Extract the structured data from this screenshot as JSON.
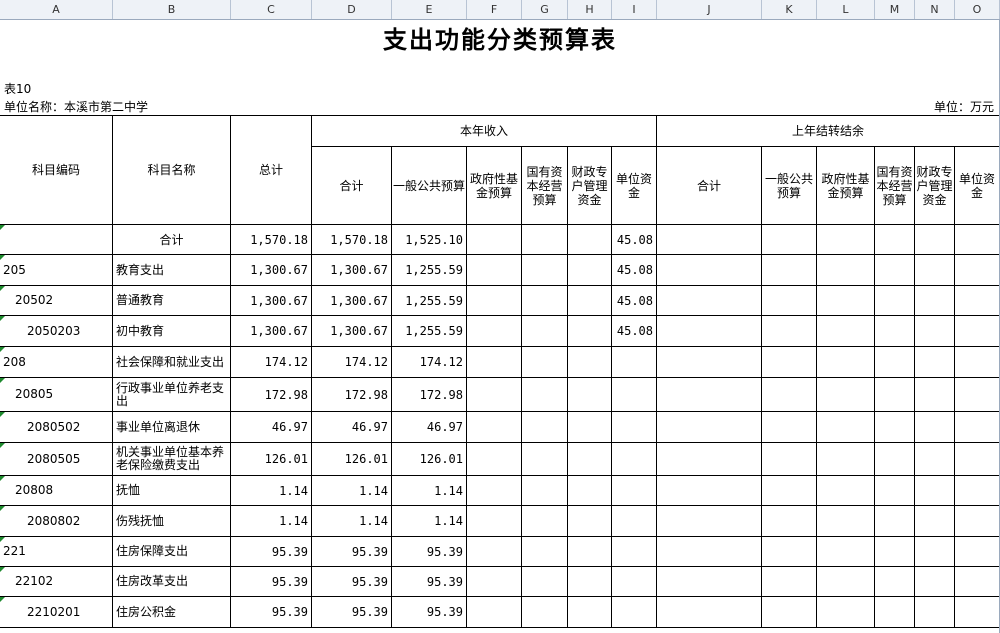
{
  "columns": [
    "A",
    "B",
    "C",
    "D",
    "E",
    "F",
    "G",
    "H",
    "I",
    "J",
    "K",
    "L",
    "M",
    "N",
    "O"
  ],
  "title": "支出功能分类预算表",
  "table_no": "表10",
  "unit_name": "单位名称：本溪市第二中学",
  "unit": "单位：万元",
  "headers": {
    "code": "科目编码",
    "name": "科目名称",
    "total": "总计",
    "current_year": "本年收入",
    "carryover": "上年结转结余",
    "sub": [
      "合计",
      "一般公共预算",
      "政府性基金预算",
      "国有资本经营预算",
      "财政专户管理资金",
      "单位资金",
      "合计",
      "一般公共预算",
      "政府性基金预算",
      "国有资本经营预算",
      "财政专户管理资金",
      "单位资金"
    ]
  },
  "rows": [
    {
      "code": "",
      "name": "合计",
      "total": "1,570.18",
      "c1": "1,570.18",
      "c2": "1,525.10",
      "unit_funds": "45.08"
    },
    {
      "code": "205",
      "name": "教育支出",
      "total": "1,300.67",
      "c1": "1,300.67",
      "c2": "1,255.59",
      "unit_funds": "45.08"
    },
    {
      "code": "20502",
      "name": "普通教育",
      "total": "1,300.67",
      "c1": "1,300.67",
      "c2": "1,255.59",
      "unit_funds": "45.08"
    },
    {
      "code": "2050203",
      "name": "初中教育",
      "total": "1,300.67",
      "c1": "1,300.67",
      "c2": "1,255.59",
      "unit_funds": "45.08"
    },
    {
      "code": "208",
      "name": "社会保障和就业支出",
      "total": "174.12",
      "c1": "174.12",
      "c2": "174.12",
      "unit_funds": ""
    },
    {
      "code": "20805",
      "name": "行政事业单位养老支出",
      "total": "172.98",
      "c1": "172.98",
      "c2": "172.98",
      "unit_funds": ""
    },
    {
      "code": "2080502",
      "name": "事业单位离退休",
      "total": "46.97",
      "c1": "46.97",
      "c2": "46.97",
      "unit_funds": ""
    },
    {
      "code": "2080505",
      "name": "机关事业单位基本养老保险缴费支出",
      "total": "126.01",
      "c1": "126.01",
      "c2": "126.01",
      "unit_funds": ""
    },
    {
      "code": "20808",
      "name": "抚恤",
      "total": "1.14",
      "c1": "1.14",
      "c2": "1.14",
      "unit_funds": ""
    },
    {
      "code": "2080802",
      "name": "伤残抚恤",
      "total": "1.14",
      "c1": "1.14",
      "c2": "1.14",
      "unit_funds": ""
    },
    {
      "code": "221",
      "name": "住房保障支出",
      "total": "95.39",
      "c1": "95.39",
      "c2": "95.39",
      "unit_funds": ""
    },
    {
      "code": "22102",
      "name": "住房改革支出",
      "total": "95.39",
      "c1": "95.39",
      "c2": "95.39",
      "unit_funds": ""
    },
    {
      "code": "2210201",
      "name": "住房公积金",
      "total": "95.39",
      "c1": "95.39",
      "c2": "95.39",
      "unit_funds": ""
    }
  ]
}
